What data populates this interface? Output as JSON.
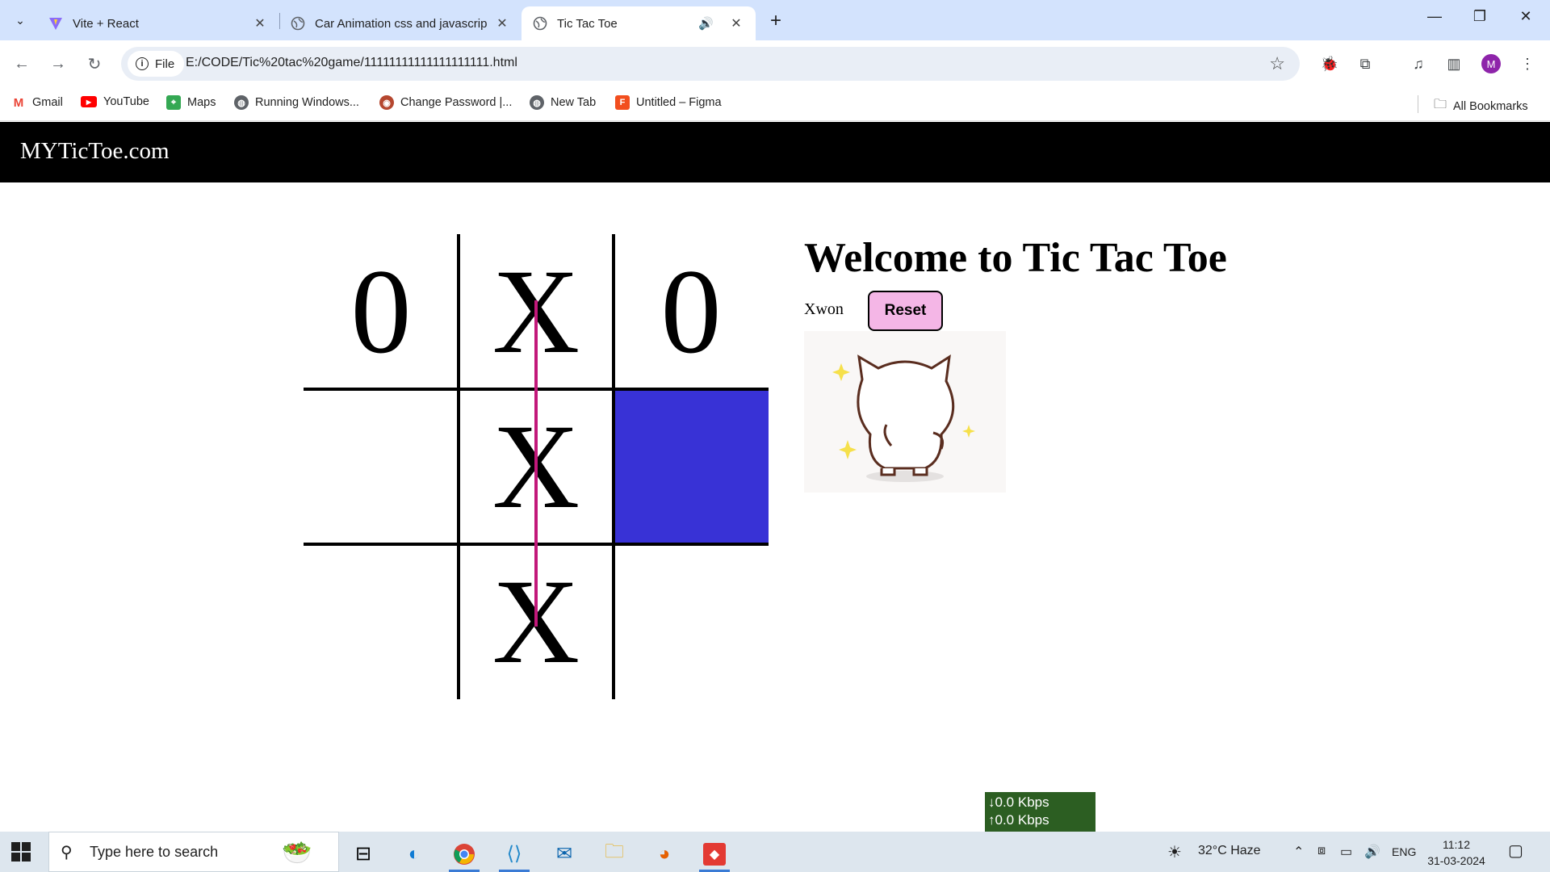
{
  "browser": {
    "tabs": [
      {
        "title": "Vite + React",
        "icon": "vite-icon"
      },
      {
        "title": "Car Animation css and javascrip",
        "icon": "globe-icon"
      },
      {
        "title": "Tic Tac Toe",
        "icon": "globe-icon",
        "active": true
      }
    ],
    "address": {
      "chip_label": "File",
      "url": "E:/CODE/Tic%20tac%20game/11111111111111111111.html"
    },
    "bookmarks": [
      {
        "label": "Gmail",
        "icon": "gmail-icon"
      },
      {
        "label": "YouTube",
        "icon": "youtube-icon"
      },
      {
        "label": "Maps",
        "icon": "maps-icon"
      },
      {
        "label": "Running Windows...",
        "icon": "globe-icon"
      },
      {
        "label": "Change Password |...",
        "icon": "site-icon"
      },
      {
        "label": "New Tab",
        "icon": "globe-icon"
      },
      {
        "label": "Untitled – Figma",
        "icon": "figma-icon"
      }
    ],
    "all_bookmarks_label": "All Bookmarks",
    "profile_initial": "M"
  },
  "site": {
    "brand": "MYTicToe.com",
    "heading": "Welcome to Tic Tac Toe",
    "status": "Xwon",
    "reset_label": "Reset",
    "board": [
      [
        "0",
        "X",
        "0"
      ],
      [
        "",
        "X",
        ""
      ],
      [
        "",
        "X",
        ""
      ]
    ],
    "highlight_color": "#3832d6",
    "win_line_color": "#c2187a",
    "reset_color": "#f4b6e6"
  },
  "netspeed": {
    "down": "0.0 Kbps",
    "up": "0.0 Kbps"
  },
  "taskbar": {
    "search_placeholder": "Type here to search",
    "weather": "32°C  Haze",
    "lang": "ENG",
    "time": "11:12",
    "date": "31-03-2024"
  }
}
